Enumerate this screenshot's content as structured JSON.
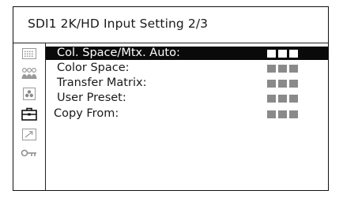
{
  "title": "SDI1 2K/HD Input Setting 2/3",
  "sidebar": {
    "tabs": [
      {
        "icon": "grid-icon",
        "active": false
      },
      {
        "icon": "people-icon",
        "active": false
      },
      {
        "icon": "color-dots-icon",
        "active": false
      },
      {
        "icon": "toolbox-icon",
        "active": true
      },
      {
        "icon": "arrow-out-icon",
        "active": false
      },
      {
        "icon": "key-icon",
        "active": false
      }
    ]
  },
  "menu": {
    "items": [
      {
        "label": "Col. Space/Mtx. Auto:",
        "selected": true,
        "indent": true
      },
      {
        "label": "Color Space:",
        "selected": false,
        "indent": true
      },
      {
        "label": "Transfer Matrix:",
        "selected": false,
        "indent": true
      },
      {
        "label": "User Preset:",
        "selected": false,
        "indent": true
      },
      {
        "label": "Copy From:",
        "selected": false,
        "indent": false
      }
    ]
  },
  "colors": {
    "selected_bg": "#0a0a0a",
    "value_block": "#8a8a8a",
    "value_block_selected": "#ffffff"
  }
}
